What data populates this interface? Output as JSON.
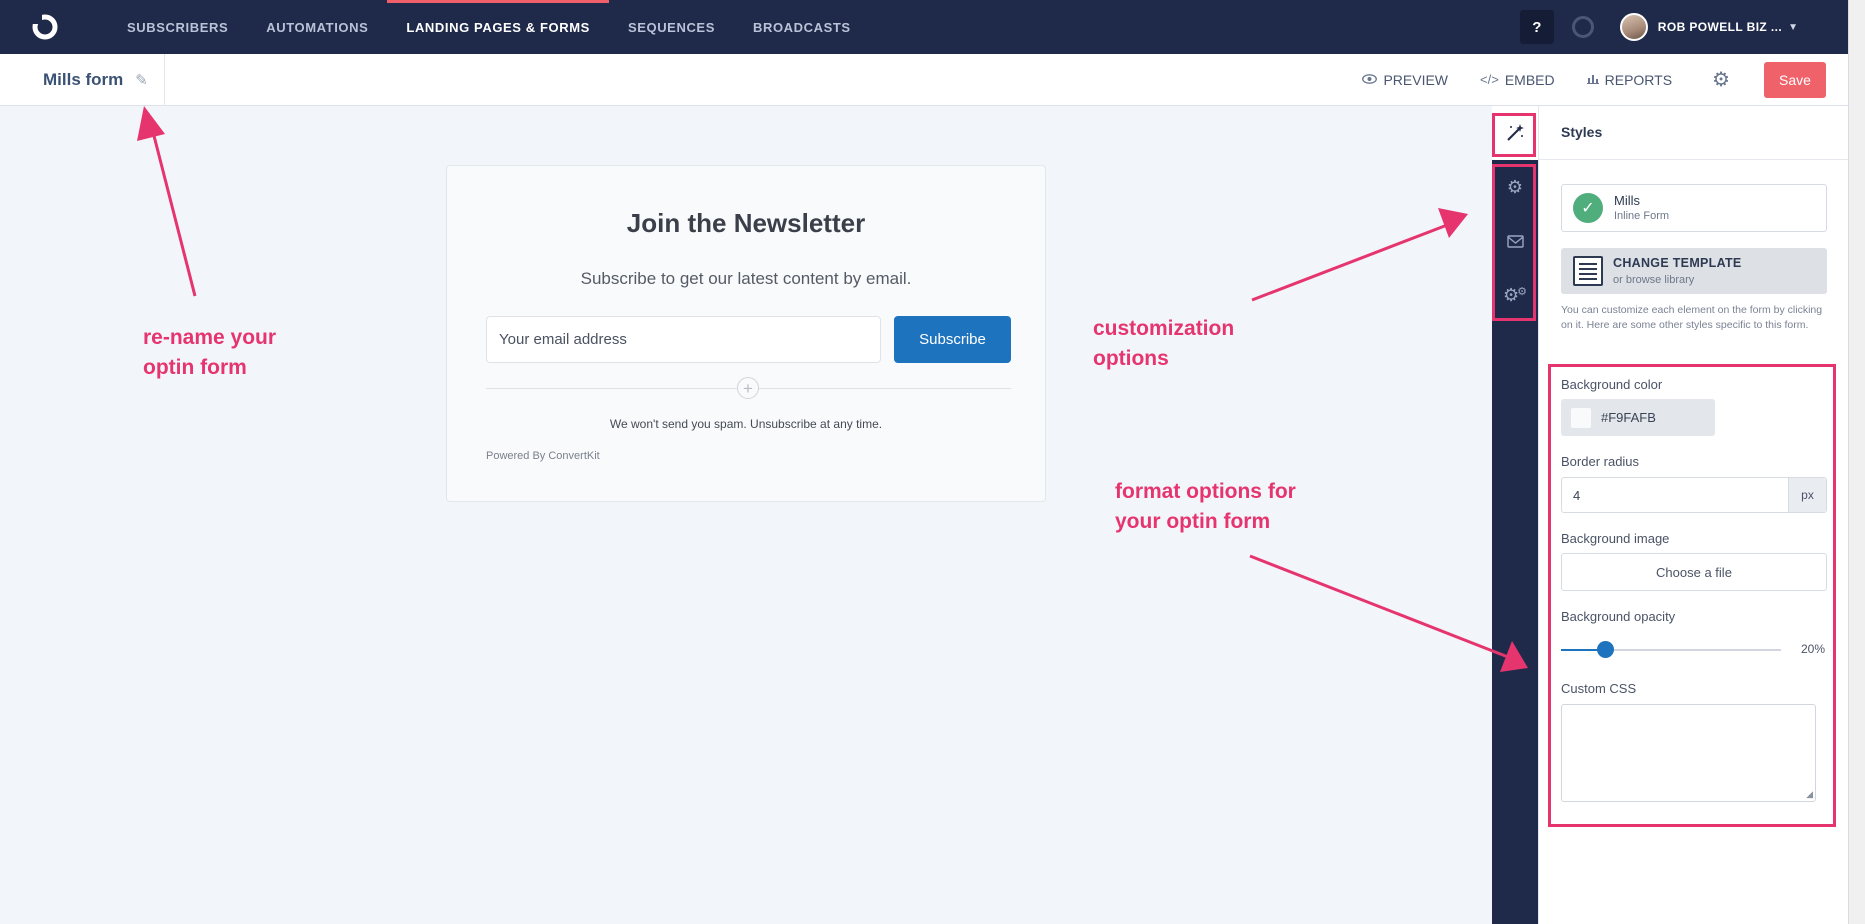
{
  "nav": {
    "items": [
      {
        "label": "SUBSCRIBERS"
      },
      {
        "label": "AUTOMATIONS"
      },
      {
        "label": "LANDING PAGES & FORMS"
      },
      {
        "label": "SEQUENCES"
      },
      {
        "label": "BROADCASTS"
      }
    ],
    "active_index": 2,
    "help_label": "?",
    "account_name": "ROB POWELL BIZ ..."
  },
  "subheader": {
    "form_title": "Mills form",
    "preview_label": "PREVIEW",
    "embed_label": "EMBED",
    "reports_label": "REPORTS",
    "save_label": "Save"
  },
  "form": {
    "title": "Join the Newsletter",
    "subtitle": "Subscribe to get our latest content by email.",
    "email_placeholder": "Your email address",
    "subscribe_label": "Subscribe",
    "spam_note": "We won't send you spam. Unsubscribe at any time.",
    "powered_by": "Powered By ConvertKit"
  },
  "panel": {
    "title": "Styles",
    "template_name": "Mills",
    "template_type": "Inline Form",
    "change_template_label": "CHANGE TEMPLATE",
    "change_template_sub": "or browse library",
    "help_text": "You can customize each element on the form by clicking on it. Here are some other styles specific to this form.",
    "background_color_label": "Background color",
    "background_color_value": "#F9FAFB",
    "border_radius_label": "Border radius",
    "border_radius_value": "4",
    "border_radius_unit": "px",
    "background_image_label": "Background image",
    "choose_file_label": "Choose a file",
    "background_opacity_label": "Background opacity",
    "background_opacity_value": "20%",
    "background_opacity_fraction": 0.2,
    "custom_css_label": "Custom CSS"
  },
  "annotations": {
    "rename_line1": "re-name your",
    "rename_line2": "optin form",
    "custom_line1": "customization",
    "custom_line2": "options",
    "format_line1": "format options for",
    "format_line2": "your optin form"
  },
  "colors": {
    "nav_bg": "#1f2a4a",
    "accent_red": "#f0626a",
    "button_blue": "#1e73be",
    "annotation_pink": "#e6356e"
  }
}
